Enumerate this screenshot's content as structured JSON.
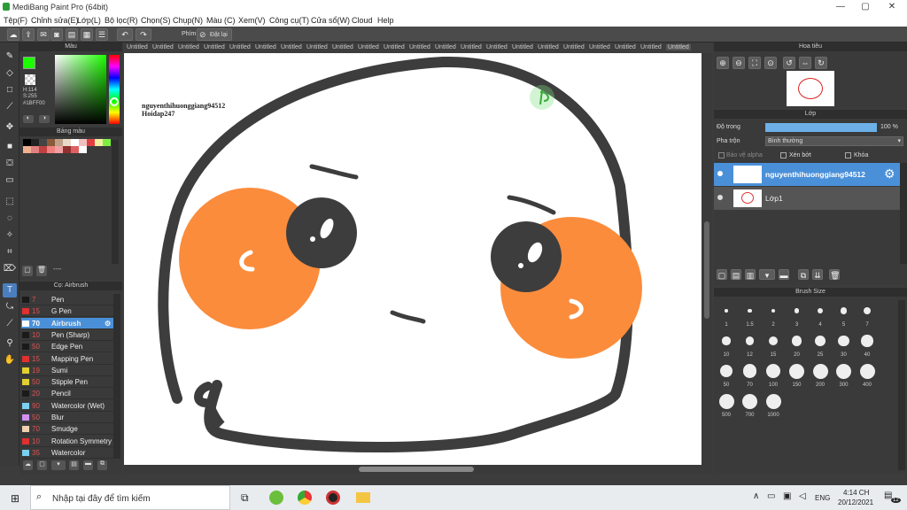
{
  "window": {
    "title": "MediBang Paint Pro (64bit)"
  },
  "menu": [
    "Tệp(F)",
    "Chỉnh sửa(E)",
    "Lớp(L)",
    "Bộ lọc(R)",
    "Chọn(S)",
    "Chụp(N)",
    "Màu (C)",
    "Xem(V)",
    "Công cụ(T)",
    "Cửa sổ(W)",
    "Cloud",
    "Help"
  ],
  "toolbar": {
    "key_label": "Phím",
    "reset_label": "Đặt lại"
  },
  "color_panel": {
    "title": "Màu",
    "h": "H:114",
    "s": "S:255",
    "hex": "#1BFF00",
    "fg_color": "#1BFF00"
  },
  "palette_panel": {
    "title": "Bảng màu",
    "dash": "----"
  },
  "brush_panel": {
    "title": "Cọ: Airbrush",
    "brushes": [
      {
        "size": "7",
        "name": "Pen",
        "color": "#1a1a1a"
      },
      {
        "size": "15",
        "name": "G Pen",
        "color": "#e03030"
      },
      {
        "size": "70",
        "name": "Airbrush",
        "color": "#ffffff",
        "selected": true
      },
      {
        "size": "10",
        "name": "Pen (Sharp)",
        "color": "#1a1a1a"
      },
      {
        "size": "50",
        "name": "Edge Pen",
        "color": "#1a1a1a"
      },
      {
        "size": "15",
        "name": "Mapping Pen",
        "color": "#e03030"
      },
      {
        "size": "19",
        "name": "Sumi",
        "color": "#e0d030"
      },
      {
        "size": "50",
        "name": "Stipple Pen",
        "color": "#e0d030"
      },
      {
        "size": "20",
        "name": "Pencil",
        "color": "#1a1a1a"
      },
      {
        "size": "90",
        "name": "Watercolor (Wet)",
        "color": "#7ad0f0"
      },
      {
        "size": "50",
        "name": "Blur",
        "color": "#d090f0"
      },
      {
        "size": "70",
        "name": "Smudge",
        "color": "#f0d0b0"
      },
      {
        "size": "10",
        "name": "Rotation Symmetry",
        "color": "#e03030"
      },
      {
        "size": "35",
        "name": "Watercolor",
        "color": "#7ad0f0"
      }
    ]
  },
  "tabs": [
    "Untitled",
    "Untitled",
    "Untitled",
    "Untitled",
    "Untitled",
    "Untitled",
    "Untitled",
    "Untitled",
    "Untitled",
    "Untitled",
    "Untitled",
    "Untitled",
    "Untitled",
    "Untitled",
    "Untitled",
    "Untitled",
    "Untitled",
    "Untitled",
    "Untitled",
    "Untitled",
    "Untitled",
    "Untitled"
  ],
  "canvas": {
    "watermark_line1": "nguyenthihuonggiang94512",
    "watermark_line2": "Hoidap247"
  },
  "navigator": {
    "title": "Hoa tiêu"
  },
  "layer_panel": {
    "title": "Lớp",
    "opacity_label": "Độ trong",
    "opacity_value": "100 %",
    "opacity_fraction": 1.0,
    "blend_label": "Pha trộn",
    "blend_value": "Bình thường",
    "protect_alpha": "Bảo vệ alpha",
    "clipping": "Xén bớt",
    "lock": "Khóa",
    "layers": [
      {
        "name": "nguyenthihuonggiang94512",
        "selected": true
      },
      {
        "name": "Lớp1",
        "selected": false
      }
    ]
  },
  "brush_size_panel": {
    "title": "Brush Size",
    "sizes": [
      "1",
      "1.5",
      "2",
      "3",
      "4",
      "5",
      "7",
      "10",
      "12",
      "15",
      "20",
      "25",
      "30",
      "40",
      "50",
      "70",
      "100",
      "150",
      "200",
      "300",
      "400",
      "500",
      "700",
      "1000"
    ]
  },
  "taskbar": {
    "search_placeholder": "Nhập tại đây để tìm kiếm",
    "time": "4:14 CH",
    "date": "20/12/2021",
    "lang": "ENG",
    "notif": "12"
  }
}
